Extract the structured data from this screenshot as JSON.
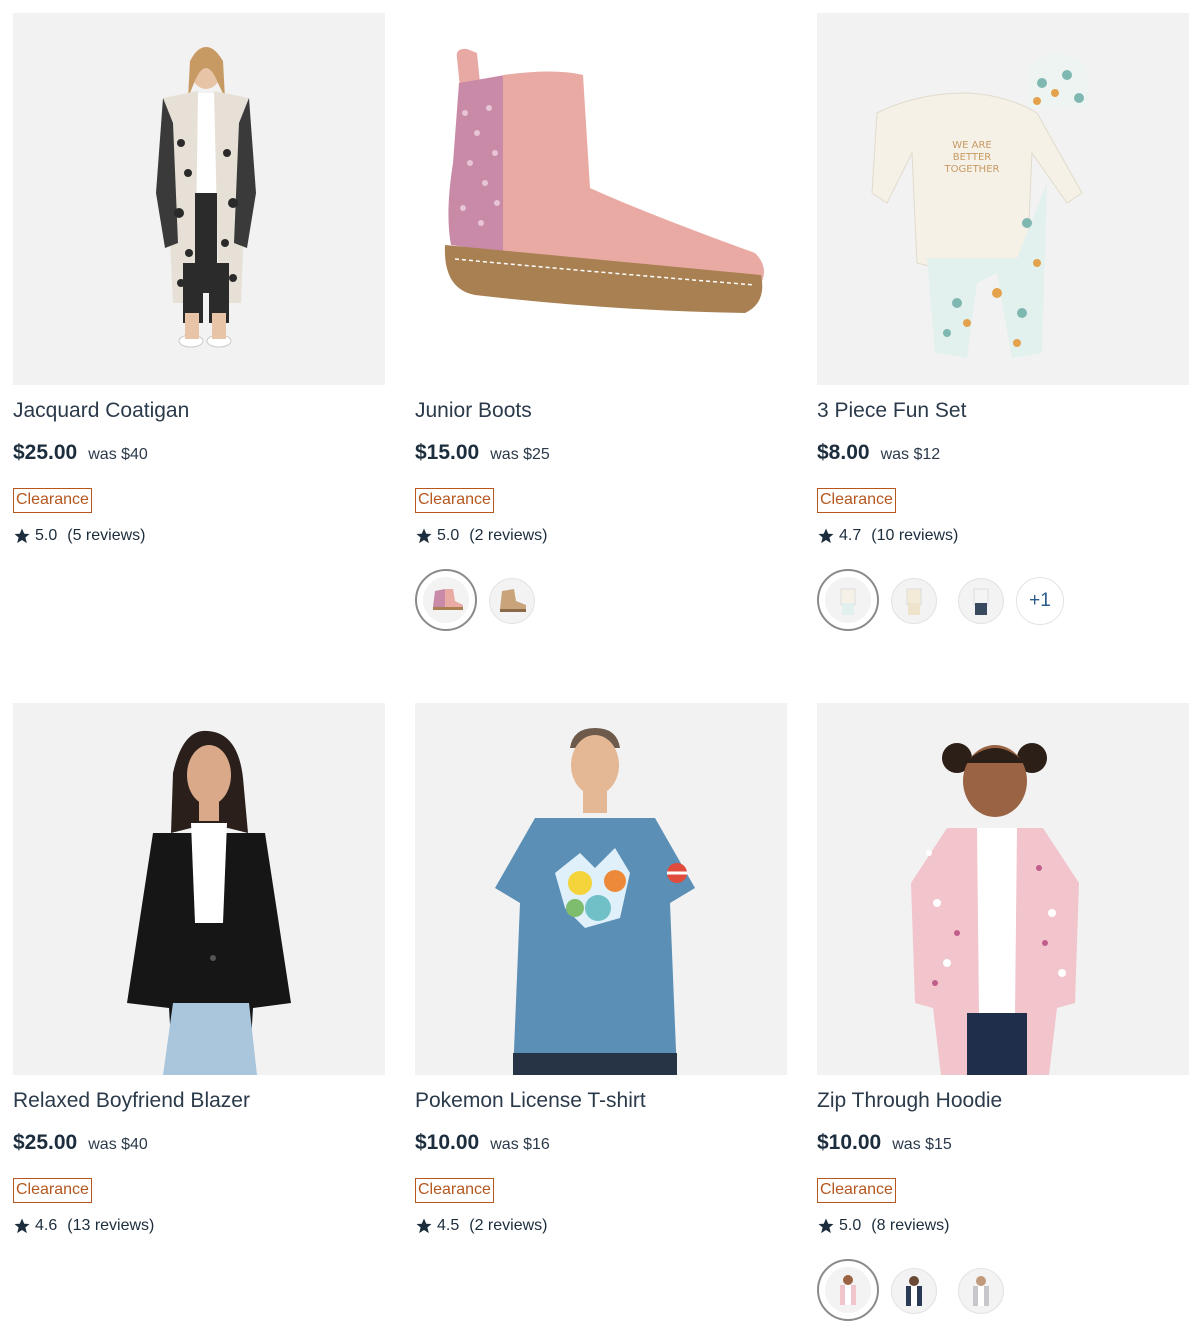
{
  "products": [
    {
      "title": "Jacquard Coatigan",
      "price": "$25.00",
      "was": "was $40",
      "badge": "Clearance",
      "rating": "5.0",
      "reviews": "(5 reviews)"
    },
    {
      "title": "Junior Boots",
      "price": "$15.00",
      "was": "was $25",
      "badge": "Clearance",
      "rating": "5.0",
      "reviews": "(2 reviews)"
    },
    {
      "title": "3 Piece Fun Set",
      "price": "$8.00",
      "was": "was $12",
      "badge": "Clearance",
      "rating": "4.7",
      "reviews": "(10 reviews)",
      "more_swatches": "+1"
    },
    {
      "title": "Relaxed Boyfriend Blazer",
      "price": "$25.00",
      "was": "was $40",
      "badge": "Clearance",
      "rating": "4.6",
      "reviews": "(13 reviews)"
    },
    {
      "title": "Pokemon License T-shirt",
      "price": "$10.00",
      "was": "was $16",
      "badge": "Clearance",
      "rating": "4.5",
      "reviews": "(2 reviews)"
    },
    {
      "title": "Zip Through Hoodie",
      "price": "$10.00",
      "was": "was $15",
      "badge": "Clearance",
      "rating": "5.0",
      "reviews": "(8 reviews)"
    }
  ],
  "colors": {
    "badge": "#b5571e",
    "text": "#1c2d3d",
    "image_bg": "#f1f1f1"
  },
  "icons": {
    "rating": "star-icon"
  }
}
